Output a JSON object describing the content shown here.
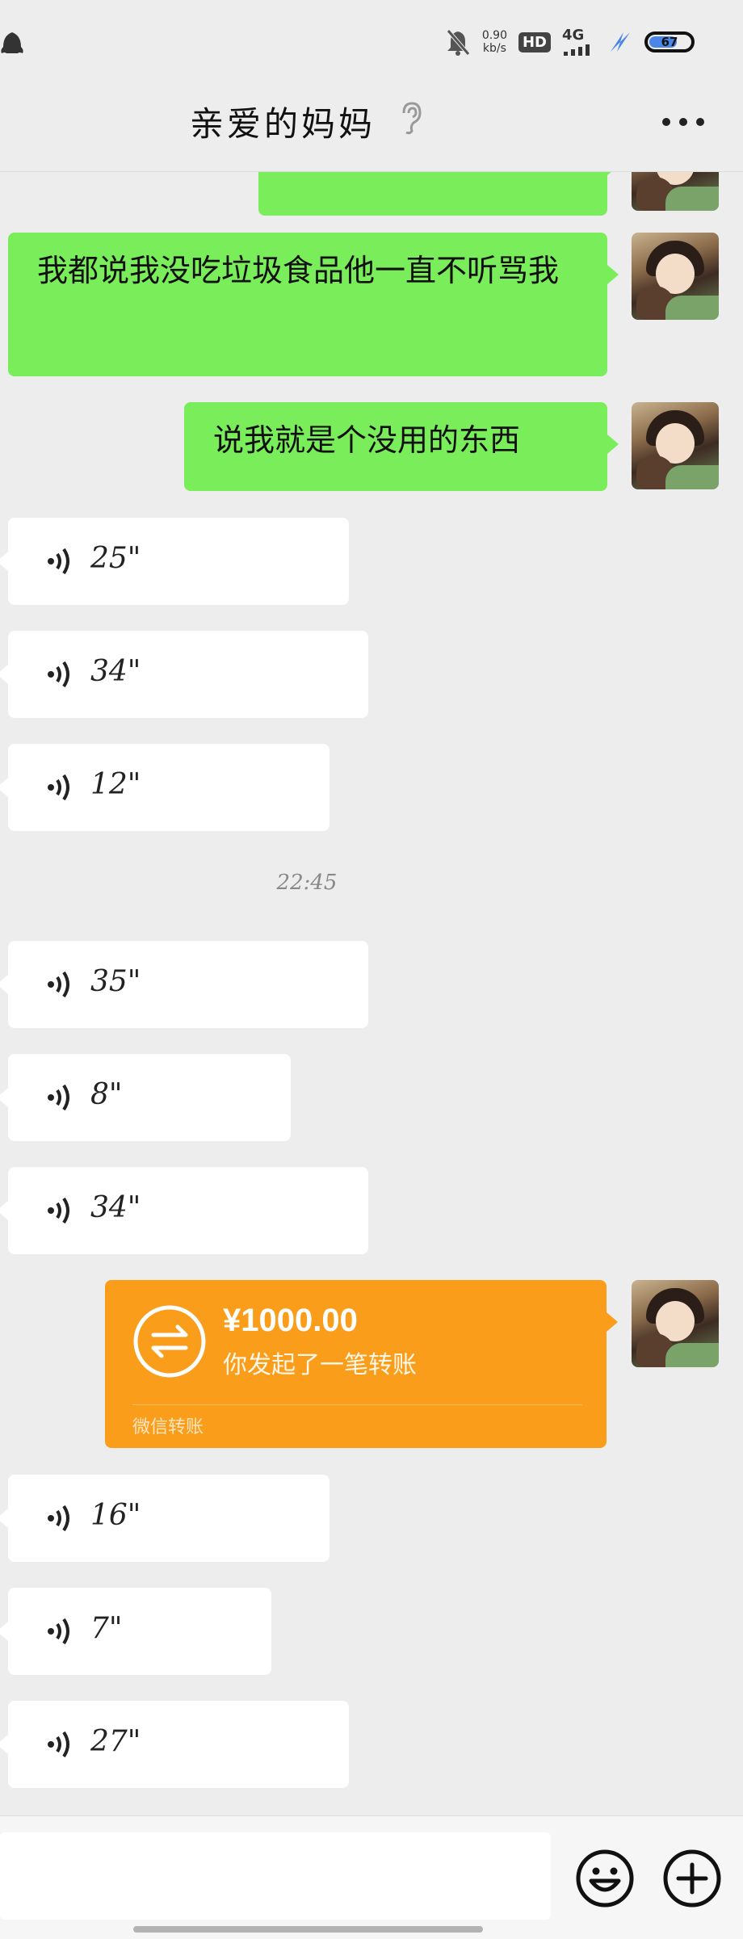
{
  "status_bar": {
    "net_speed_value": "0.90",
    "net_speed_unit": "kb/s",
    "hd_label": "HD",
    "network_label": "4G",
    "battery_level": "67",
    "battery_fraction": 0.67,
    "icons": [
      "qq-icon",
      "mute-bell-icon",
      "signal-icon",
      "charging-icon",
      "battery-icon"
    ]
  },
  "header": {
    "title": "亲爱的妈妈",
    "icons": [
      "ear-icon",
      "more-icon"
    ]
  },
  "messages": {
    "m1": {
      "side": "right",
      "type": "text",
      "text": "我都说我没吃垃圾食品他一直不听骂我"
    },
    "m2": {
      "side": "right",
      "type": "text",
      "text": "说我就是个没用的东西"
    },
    "voice1": {
      "duration": "25\""
    },
    "voice2": {
      "duration": "34\""
    },
    "voice3": {
      "duration": "12\""
    },
    "timestamp": "22:45",
    "voice4": {
      "duration": "35\""
    },
    "voice5": {
      "duration": "8\""
    },
    "voice6": {
      "duration": "34\""
    },
    "transfer": {
      "amount": "¥1000.00",
      "description": "你发起了一笔转账",
      "label": "微信转账",
      "color": "#fa9d1b"
    },
    "voice7": {
      "duration": "16\""
    },
    "voice8": {
      "duration": "7\""
    },
    "voice9": {
      "duration": "27\""
    }
  },
  "input_bar": {
    "placeholder": "",
    "icons": [
      "emoji-icon",
      "plus-icon"
    ]
  },
  "colors": {
    "background": "#ededed",
    "sent_bubble": "#79ed5a",
    "received_bubble": "#ffffff",
    "transfer": "#fa9d1b"
  }
}
